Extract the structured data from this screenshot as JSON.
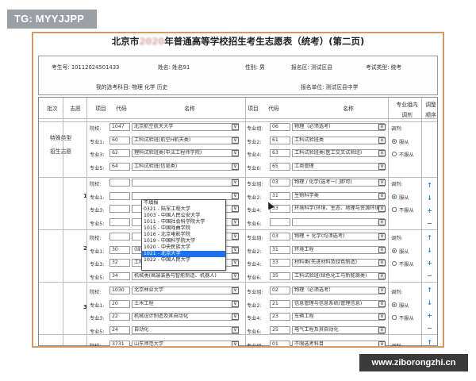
{
  "watermark": "TG: MYYJJPP",
  "site": "www.ziborongzhi.cn",
  "title": {
    "pre": "北京市",
    "blur": "2020",
    "post": "年普通高等学校招生考生志愿表（统考）(第二页)"
  },
  "info": {
    "exam_no": "考生号: 10112024501433",
    "name": "姓名: 姓名91",
    "gender": "性别: 男",
    "district": "报名区: 测试区县",
    "type": "考试类型: 统考",
    "subjects": "我的选考科目: 物理 化学 历史",
    "unit": "报名单位: 测试区县中学"
  },
  "headers": {
    "batch": "批次",
    "choice": "志愿",
    "item": "项目",
    "code": "代码",
    "name": "名称",
    "item2": "项目",
    "code2": "代码",
    "name2": "名称",
    "adjust1": "专业组内",
    "adjust2": "调剂",
    "order1": "调整",
    "order2": "顺序"
  },
  "special": {
    "l1": "特殊类型",
    "l2": "招生志愿"
  },
  "rows": [
    {
      "label": "院校:",
      "code": "1047",
      "name": "北京航空航天大学",
      "label2": "专业组:",
      "code2": "06",
      "name2": "物理（必须选考）",
      "right": "调剂:"
    },
    {
      "label": "专业1:",
      "code": "60",
      "name": "工科试验班(航空H航天类)",
      "label2": "专业2:",
      "code2": "61",
      "name2": "工科试验班类",
      "right": "服从"
    },
    {
      "label": "专业3:",
      "code": "62",
      "name": "理科试验班类(中法工程师学院)",
      "label2": "专业4:",
      "code2": "63",
      "name2": "工科试验班类(医工交叉试验班)",
      "right": "不服从"
    },
    {
      "label": "专业5:",
      "code": "64",
      "name": "工科试验班(信息类)",
      "label2": "专业6:",
      "code2": "65",
      "name2": "工商管理",
      "right": ""
    },
    {
      "label": "院校:",
      "code": "",
      "name": "",
      "label2": "专业组:",
      "code2": "03",
      "name2": "物理 / 化学(选考一门即可)",
      "right": "调剂:"
    },
    {
      "label": "专业1:",
      "code": "",
      "name": "",
      "label2": "专业2:",
      "code2": "31",
      "name2": "生物科学类",
      "right": "服从"
    },
    {
      "label": "专业3:",
      "code": "",
      "name": "",
      "label2": "专业4:",
      "code2": "33",
      "name2": "环境科学(环境、生态、地理与资源环境)",
      "right": "不服从"
    },
    {
      "label": "专业5:",
      "code": "",
      "name": "",
      "label2": "专业6:",
      "code2": "",
      "name2": "",
      "right": ""
    },
    {
      "label": "院校:",
      "code": "",
      "name": "",
      "label2": "专业组:",
      "code2": "03",
      "name2": "物理 + 化学(均须选考)",
      "right": "调剂:"
    },
    {
      "label": "专业1:",
      "code": "30",
      "name": "(绿色化工与新能源类)",
      "label2": "专业2:",
      "code2": "31",
      "name2": "环境工程",
      "right": "服从"
    },
    {
      "label": "专业3:",
      "code": "32",
      "name": "工科试验班(高材精英班)",
      "label2": "专业4:",
      "code2": "33",
      "name2": "材料类(先进材料及绿色制造)",
      "right": "不服从"
    },
    {
      "label": "专业5:",
      "code": "34",
      "name": "机械类(高端装备与智能制造、机器人)",
      "label2": "专业6:",
      "code2": "35",
      "name2": "工科试验班(绿色化工与新能源类)",
      "right": ""
    },
    {
      "label": "院校:",
      "code": "1030",
      "name": "北京林业大学",
      "label2": "专业组:",
      "code2": "02",
      "name2": "物理（必须选考）",
      "right": "调剂:"
    },
    {
      "label": "专业1:",
      "code": "20",
      "name": "土木工程",
      "label2": "专业2:",
      "code2": "21",
      "name2": "信息管理与信息系统(管理信息)",
      "right": "服从"
    },
    {
      "label": "专业3:",
      "code": "22",
      "name": "机械设计制造及其自动化",
      "label2": "专业4:",
      "code2": "23",
      "name2": "车辆工程",
      "right": "不服从"
    },
    {
      "label": "专业5:",
      "code": "24",
      "name": "自动化",
      "label2": "专业6:",
      "code2": "25",
      "name2": "电气工程及其自动化",
      "right": ""
    },
    {
      "label": "院校:",
      "code": "3731",
      "name": "山东师范大学",
      "label2": "专业组:",
      "code2": "01",
      "name2": "不限选考科目",
      "right": "调剂:"
    }
  ],
  "choices": [
    "1",
    "2",
    "3"
  ],
  "dropdown": {
    "header": "不填报",
    "options": [
      "0321 - 陆军工程大学",
      "1003 - 中国人民公安大学",
      "1011 - 中国社会科学院大学",
      "1015 - 中国戏曲学院",
      "1016 - 北京电影学院",
      "1019 - 中国科学院大学",
      "1020 - 中央民族大学",
      "1021 - 北京大学",
      "1022 - 中国人民大学"
    ],
    "selected": "1021 - 北京大学"
  },
  "arrows": [
    "↑",
    "↓",
    "+",
    "−"
  ],
  "dd_glyph": "∨"
}
